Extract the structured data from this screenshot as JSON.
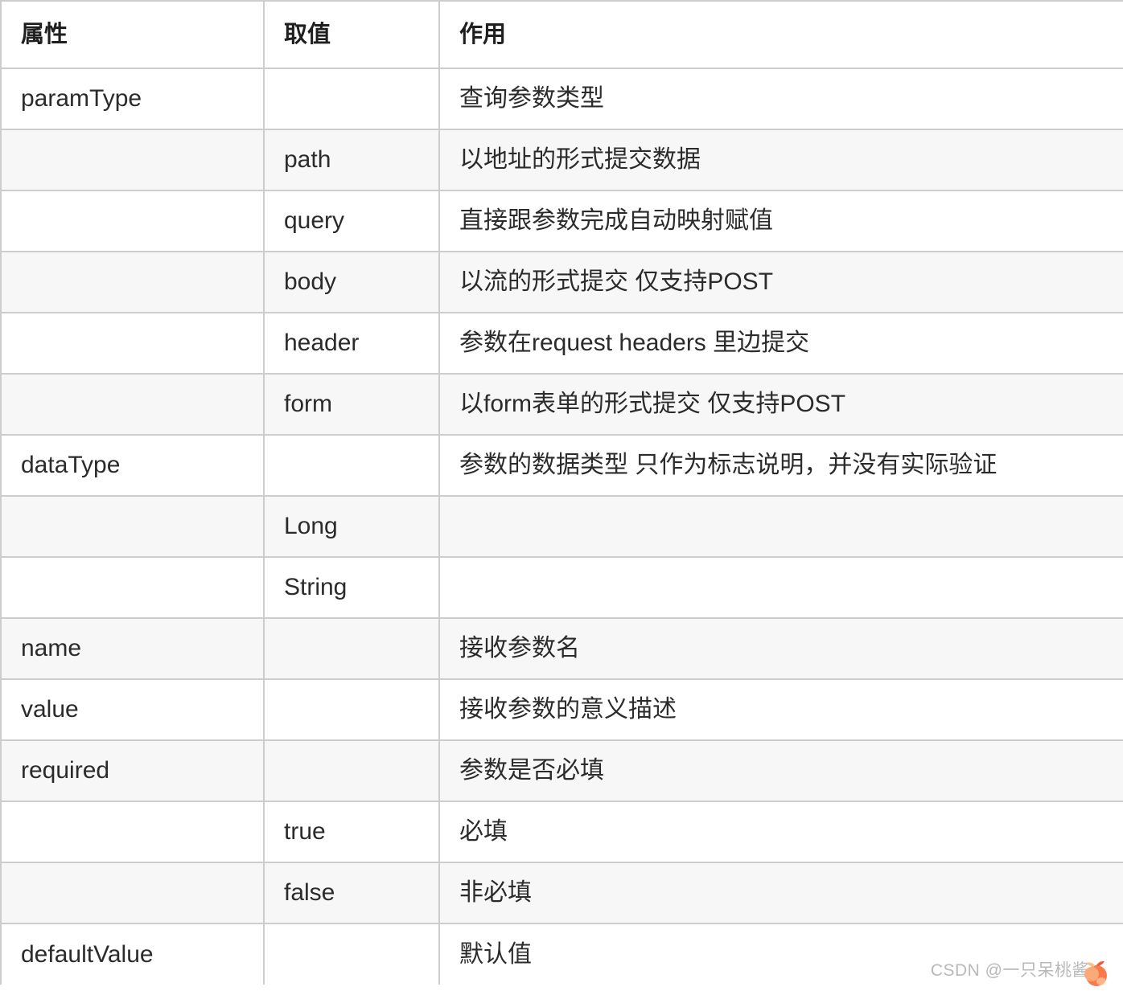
{
  "table": {
    "columns": [
      "属性",
      "取值",
      "作用"
    ],
    "rows": [
      {
        "attr": "paramType",
        "value": "",
        "desc": "查询参数类型",
        "stripe": false
      },
      {
        "attr": "",
        "value": "path",
        "desc": "以地址的形式提交数据",
        "stripe": true
      },
      {
        "attr": "",
        "value": "query",
        "desc": "直接跟参数完成自动映射赋值",
        "stripe": false
      },
      {
        "attr": "",
        "value": "body",
        "desc": "以流的形式提交 仅支持POST",
        "stripe": true
      },
      {
        "attr": "",
        "value": "header",
        "desc": "参数在request headers 里边提交",
        "stripe": false
      },
      {
        "attr": "",
        "value": "form",
        "desc": "以form表单的形式提交 仅支持POST",
        "stripe": true
      },
      {
        "attr": "dataType",
        "value": "",
        "desc": "参数的数据类型 只作为标志说明，并没有实际验证",
        "stripe": false
      },
      {
        "attr": "",
        "value": "Long",
        "desc": "",
        "stripe": true
      },
      {
        "attr": "",
        "value": "String",
        "desc": "",
        "stripe": false
      },
      {
        "attr": "name",
        "value": "",
        "desc": "接收参数名",
        "stripe": true
      },
      {
        "attr": "value",
        "value": "",
        "desc": "接收参数的意义描述",
        "stripe": false
      },
      {
        "attr": "required",
        "value": "",
        "desc": "参数是否必填",
        "stripe": true
      },
      {
        "attr": "",
        "value": "true",
        "desc": "必填",
        "stripe": false
      },
      {
        "attr": "",
        "value": "false",
        "desc": "非必填",
        "stripe": true
      },
      {
        "attr": "defaultValue",
        "value": "",
        "desc": "默认值",
        "stripe": false
      }
    ]
  },
  "watermark": {
    "text": "CSDN @一只呆桃酱",
    "emoji_icon": "peach-emoji-icon"
  },
  "colors": {
    "border": "#cdcdcd",
    "stripe": "#f7f7f7",
    "text": "#2b2b2b",
    "header_text": "#1f1f1f",
    "watermark_text": "#b9b9b9"
  }
}
